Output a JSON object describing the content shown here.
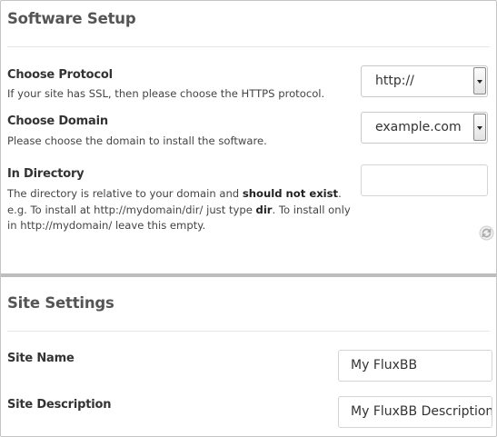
{
  "software_setup": {
    "title": "Software Setup",
    "protocol": {
      "label": "Choose Protocol",
      "help": "If your site has SSL, then please choose the HTTPS protocol.",
      "value": "http://"
    },
    "domain": {
      "label": "Choose Domain",
      "help": "Please choose the domain to install the software.",
      "value": "example.com"
    },
    "directory": {
      "label": "In Directory",
      "help_part1": "The directory is relative to your domain and ",
      "help_bold1": "should not exist",
      "help_part2": ". e.g. To install at http://mydomain/dir/ just type ",
      "help_bold2": "dir",
      "help_part3": ". To install only in http://mydomain/ leave this empty.",
      "value": ""
    },
    "refresh_icon": "refresh-icon"
  },
  "site_settings": {
    "title": "Site Settings",
    "site_name": {
      "label": "Site Name",
      "value": "My FluxBB"
    },
    "site_description": {
      "label": "Site Description",
      "value": "My FluxBB Description"
    }
  }
}
